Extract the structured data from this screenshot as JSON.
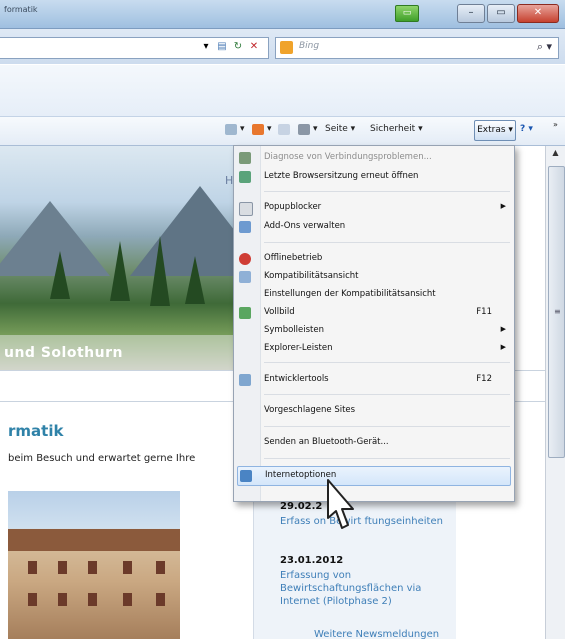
{
  "window": {
    "title_fragment": "formatik",
    "controls": {
      "minimize": "–",
      "maximize": "▭",
      "close": "✕"
    }
  },
  "search": {
    "placeholder": "Bing",
    "go_icon": "magnifier-icon"
  },
  "commandbar": {
    "seite": "Seite ▾",
    "sicherheit": "Sicherheit ▾",
    "extras": "Extras ▾",
    "help": "? ▾",
    "overflow": "»"
  },
  "menu": {
    "items": [
      {
        "label": "Diagnose von Verbindungsproblemen...",
        "disabled": true,
        "icon": "network-diagnose-icon"
      },
      {
        "label": "Letzte Browsersitzung erneut öffnen",
        "icon": "reopen-session-icon"
      },
      {
        "label": "Popupblocker",
        "submenu": true,
        "icon": "popup-blocker-icon"
      },
      {
        "label": "Add-Ons verwalten",
        "icon": "addons-icon"
      },
      {
        "label": "Offlinebetrieb",
        "icon": "offline-icon"
      },
      {
        "label": "Kompatibilitätsansicht",
        "icon": "compatibility-icon"
      },
      {
        "label": "Einstellungen der Kompatibilitätsansicht"
      },
      {
        "label": "Vollbild",
        "shortcut": "F11",
        "icon": "fullscreen-icon"
      },
      {
        "label": "Symbolleisten",
        "submenu": true
      },
      {
        "label": "Explorer-Leisten",
        "submenu": true
      },
      {
        "label": "Entwicklertools",
        "shortcut": "F12",
        "icon": "devtools-icon"
      },
      {
        "label": "Vorgeschlagene Sites"
      },
      {
        "label": "Senden an Bluetooth-Gerät..."
      },
      {
        "label": "Internetoptionen",
        "selected": true,
        "icon": "internet-options-icon"
      }
    ]
  },
  "page": {
    "banner_text": "und Solothurn",
    "banner_link": "H",
    "heading": "rmatik",
    "paragraph": "beim Besuch und erwartet gerne Ihre",
    "news": [
      {
        "date": "29.02.2",
        "text": "Erfass       on Bewirt     ftungseinheiten"
      },
      {
        "date": "23.01.2012",
        "text": "Erfassung von Bewirtschaftungsflächen via Internet (Pilotphase 2)"
      }
    ],
    "more_news": "Weitere Newsmeldungen"
  },
  "colors": {
    "accent_link": "#3f7fb8",
    "heading": "#2f82a8",
    "menu_bg": "#f5f5f5",
    "close_button": "#c6412f"
  }
}
